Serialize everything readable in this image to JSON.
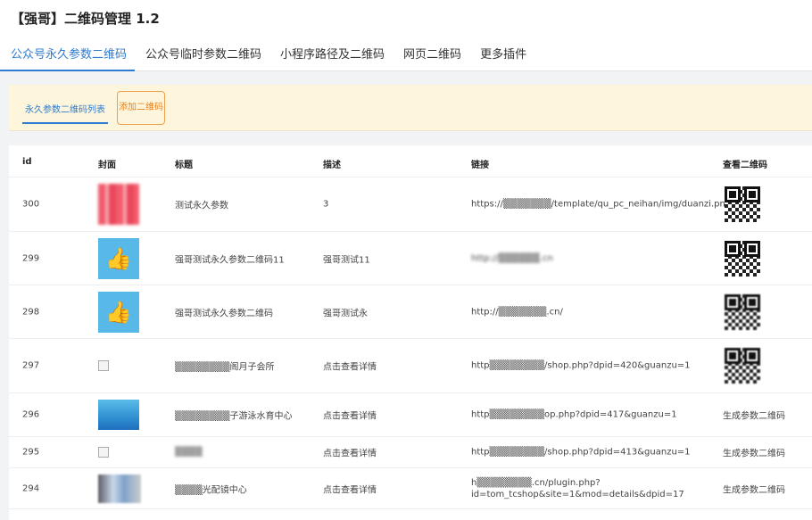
{
  "app": {
    "title": "【强哥】二维码管理 1.2"
  },
  "tabs": [
    {
      "label": "公众号永久参数二维码",
      "active": true
    },
    {
      "label": "公众号临时参数二维码",
      "active": false
    },
    {
      "label": "小程序路径及二维码",
      "active": false
    },
    {
      "label": "网页二维码",
      "active": false
    },
    {
      "label": "更多插件",
      "active": false
    }
  ],
  "subnav": {
    "list_label": "永久参数二维码列表",
    "add_label": "添加二维码"
  },
  "table": {
    "headers": {
      "id": "id",
      "cover": "封面",
      "title": "标题",
      "desc": "描述",
      "link": "链接",
      "qr": "查看二维码"
    },
    "rows": [
      {
        "id": "300",
        "title": "测试永久参数",
        "desc": "3",
        "link": "https://▒▒▒▒▒▒▒/template/qu_pc_neihan/img/duanzi.png",
        "qr": "qr-code"
      },
      {
        "id": "299",
        "title": "强哥测试永久参数二维码11",
        "desc": "强哥测试11",
        "link": "http://▒▒▒▒▒▒.cn",
        "qr": "qr-code"
      },
      {
        "id": "298",
        "title": "强哥测试永久参数二维码",
        "desc": "强哥测试永",
        "link": "http://▒▒▒▒▒▒▒.cn/",
        "qr": "qr-code"
      },
      {
        "id": "297",
        "title": "▒▒▒▒▒▒▒▒阁月子会所",
        "desc": "点击查看详情",
        "link": "http▒▒▒▒▒▒▒▒/shop.php?dpid=420&guanzu=1",
        "qr": "qr-code"
      },
      {
        "id": "296",
        "title": "▒▒▒▒▒▒▒▒子游泳水育中心",
        "desc": "点击查看详情",
        "link": "http▒▒▒▒▒▒▒▒op.php?dpid=417&guanzu=1",
        "qr": "生成参数二维码"
      },
      {
        "id": "295",
        "title": "▒▒▒▒",
        "desc": "点击查看详情",
        "link": "http▒▒▒▒▒▒▒▒/shop.php?dpid=413&guanzu=1",
        "qr": "生成参数二维码"
      },
      {
        "id": "294",
        "title": "▒▒▒▒光配镜中心",
        "desc": "点击查看详情",
        "link": "h▒▒▒▒▒▒▒▒.cn/plugin.php?",
        "link2": "id=tom_tcshop&site=1&mod=details&dpid=17",
        "qr": "生成参数二维码"
      }
    ]
  },
  "colors": {
    "accent": "#2e7bd1",
    "warn": "#e8811c",
    "subbar_bg": "#fdf5dc"
  }
}
